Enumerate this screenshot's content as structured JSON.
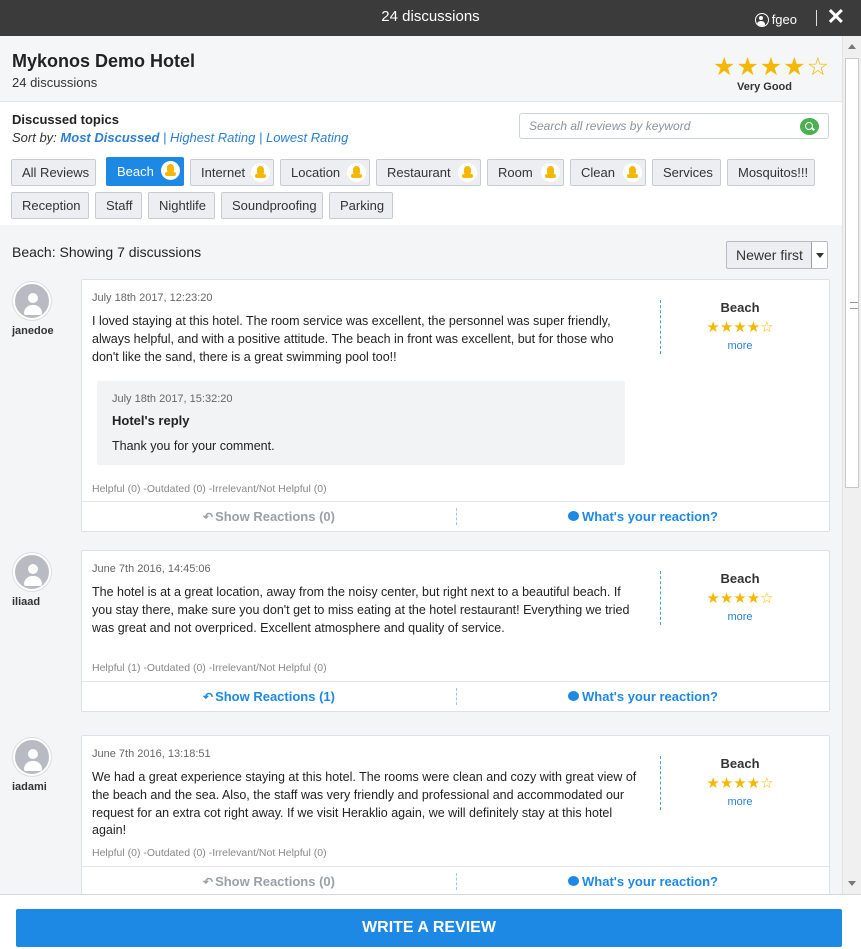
{
  "window": {
    "title": "24 discussions",
    "user": "fgeo",
    "user_icon": "user-icon",
    "close_icon": "close-icon"
  },
  "hotel": {
    "name": "Mykonos Demo Hotel",
    "discussions": "24 discussions",
    "stars": "★★★★☆",
    "rating_label": "Very Good"
  },
  "topics": {
    "title": "Discussed topics",
    "sort_prefix": "Sort by:",
    "sort_options": [
      "Most Discussed",
      "Highest Rating",
      "Lowest Rating"
    ],
    "sort_sep": "|",
    "active_sort": "Most Discussed",
    "search_placeholder": "Search all reviews by keyword",
    "search_value": "",
    "tags": [
      {
        "label": "All Reviews",
        "active": false,
        "badge": false
      },
      {
        "label": "Beach",
        "active": true,
        "badge": true
      },
      {
        "label": "Internet",
        "active": false,
        "badge": true
      },
      {
        "label": "Location",
        "active": false,
        "badge": true
      },
      {
        "label": "Restaurant",
        "active": false,
        "badge": true
      },
      {
        "label": "Room",
        "active": false,
        "badge": true
      },
      {
        "label": "Clean",
        "active": false,
        "badge": true
      },
      {
        "label": "Services",
        "active": false,
        "badge": false
      },
      {
        "label": "Mosquitos!!!",
        "active": false,
        "badge": false
      },
      {
        "label": "Reception",
        "active": false,
        "badge": false
      },
      {
        "label": "Staff",
        "active": false,
        "badge": false
      },
      {
        "label": "Nightlife",
        "active": false,
        "badge": false
      },
      {
        "label": "Soundproofing",
        "active": false,
        "badge": false
      },
      {
        "label": "Parking",
        "active": false,
        "badge": false
      }
    ]
  },
  "results": {
    "topic": "Beach",
    "summary": ": Showing 7 discussions",
    "order": "Newer first"
  },
  "reviews": [
    {
      "user": "janedoe",
      "date": "July 18th 2017, 12:23:20",
      "text": "I loved staying at this hotel. The room service was excellent, the personnel was super friendly, always helpful, and with a positive attitude. The beach in front was excellent, but for those who don't like the sand, there is a great swimming pool too!!",
      "topic": "Beach",
      "stars": "★★★★☆",
      "more": "more",
      "reply": {
        "date": "July 18th 2017, 15:32:20",
        "title": "Hotel's reply",
        "text": "Thank you for your comment."
      },
      "helpful": "Helpful (0) -Outdated (0) -Irrelevant/Not Helpful (0)",
      "show_reactions": "Show Reactions (0)",
      "reactions_enabled": false,
      "react": "What's your reaction?"
    },
    {
      "user": "iliaad",
      "date": "June 7th 2016, 14:45:06",
      "text": "The hotel is at a great location, away from the noisy center, but right next to a beautiful beach. If you stay there, make sure you don't get to miss eating at the hotel restaurant! Everything we tried was great and not overpriced. Excellent atmosphere and quality of service.",
      "topic": "Beach",
      "stars": "★★★★☆",
      "more": "more",
      "helpful": "Helpful (1) -Outdated (0) -Irrelevant/Not Helpful (0)",
      "show_reactions": "Show Reactions (1)",
      "reactions_enabled": true,
      "react": "What's your reaction?"
    },
    {
      "user": "iadami",
      "date": "June 7th 2016, 13:18:51",
      "text": "We had a great experience staying at this hotel. The rooms were clean and cozy with great view of the beach and the sea. Also, the staff was very friendly and professional and accommodated our request for an extra cot right away. If we visit Heraklio again, we will definitely stay at this hotel again!",
      "topic": "Beach",
      "stars": "★★★★☆",
      "more": "more",
      "helpful": "Helpful (0) -Outdated (0) -Irrelevant/Not Helpful (0)",
      "show_reactions": "Show Reactions (0)",
      "reactions_enabled": false,
      "react": "What's your reaction?"
    }
  ],
  "footer": {
    "write_review": "WRITE A REVIEW"
  },
  "colors": {
    "accent": "#1e88e5",
    "star": "#f5b800",
    "topbar": "#3b3b3b",
    "search_button": "#4caf50"
  }
}
